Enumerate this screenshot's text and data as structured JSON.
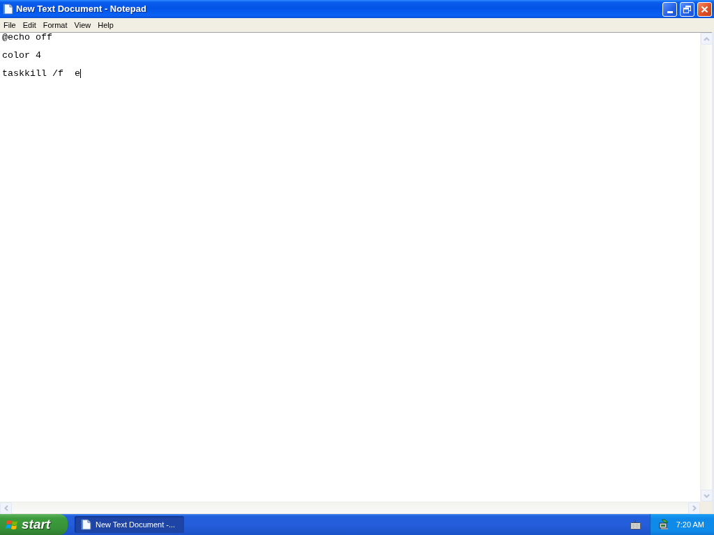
{
  "window": {
    "title": "New Text Document - Notepad"
  },
  "menu_bar": [
    "File",
    "Edit",
    "Format",
    "View",
    "Help"
  ],
  "editor": {
    "text": "@echo off\n\ncolor 4\n\ntaskkill /f  e",
    "focused": true
  },
  "taskbar": {
    "start_label": "start",
    "tasks": [
      {
        "label": "New Text Document -...",
        "selected": true
      }
    ],
    "clock": "7:20 AM"
  }
}
